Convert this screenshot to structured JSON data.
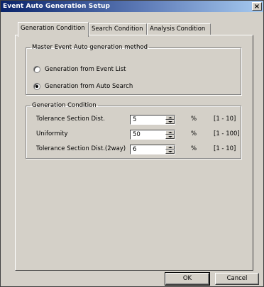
{
  "window": {
    "title": "Event Auto Generation Setup",
    "close_glyph": "×"
  },
  "tabs": [
    {
      "label": "Generation Condition",
      "active": true
    },
    {
      "label": "Search Condition",
      "active": false
    },
    {
      "label": "Analysis Condition",
      "active": false
    }
  ],
  "method_group": {
    "legend": "Master Event Auto generation method",
    "options": [
      {
        "label": "Generation from Event List",
        "checked": false
      },
      {
        "label": "Generation from Auto Search",
        "checked": true
      }
    ]
  },
  "condition_group": {
    "legend": "Generation Condition",
    "fields": [
      {
        "label": "Tolerance Section Dist.",
        "value": "5",
        "unit": "%",
        "range": "[1 - 10]"
      },
      {
        "label": "Uniformity",
        "value": "50",
        "unit": "%",
        "range": "[1 - 100]"
      },
      {
        "label": "Tolerance Section Dist.(2way)",
        "value": "6",
        "unit": "%",
        "range": "[1 - 10]"
      }
    ]
  },
  "buttons": {
    "ok": "OK",
    "cancel": "Cancel"
  },
  "colors": {
    "face": "#d4d0c8",
    "title_start": "#0a246a",
    "title_end": "#a6caf0"
  }
}
